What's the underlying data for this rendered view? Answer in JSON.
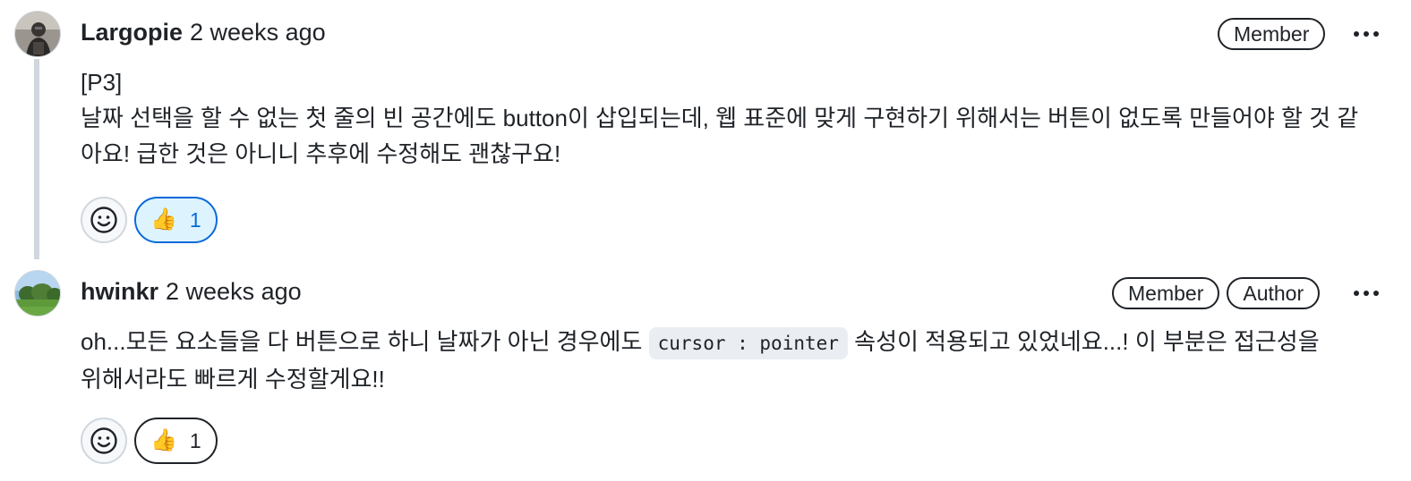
{
  "comments": [
    {
      "author": "Largopie",
      "timestamp": "2 weeks ago",
      "badges": [
        "Member"
      ],
      "body_lines": [
        "[P3]",
        "날짜 선택을 할 수 없는 첫 줄의 빈 공간에도 button이 삽입되는데, 웹 표준에 맞게 구현하기 위해서는 버튼이 없도록 만들어야 할 것 같",
        "아요! 급한 것은 아니니 추후에 수정해도 괜찮구요!"
      ],
      "reaction": {
        "emoji": "👍",
        "count": "1",
        "reacted_by_viewer": true
      }
    },
    {
      "author": "hwinkr",
      "timestamp": "2 weeks ago",
      "badges": [
        "Member",
        "Author"
      ],
      "body_before_code": "oh...모든 요소들을 다 버튼으로 하니 날짜가 아닌 경우에도 ",
      "body_code": "cursor : pointer",
      "body_after_code": " 속성이 적용되고 있었네요...! 이 부분은 접근성을",
      "body_line2": "위해서라도 빠르게 수정할게요!!",
      "reaction": {
        "emoji": "👍",
        "count": "1",
        "reacted_by_viewer": false
      }
    }
  ],
  "icons": {
    "more": "kebab-horizontal-icon",
    "add_reaction": "smiley-icon"
  },
  "colors": {
    "accent": "#0969da",
    "accent_bg": "#ddf4ff",
    "border": "#d0d7de",
    "text": "#1f2328"
  }
}
